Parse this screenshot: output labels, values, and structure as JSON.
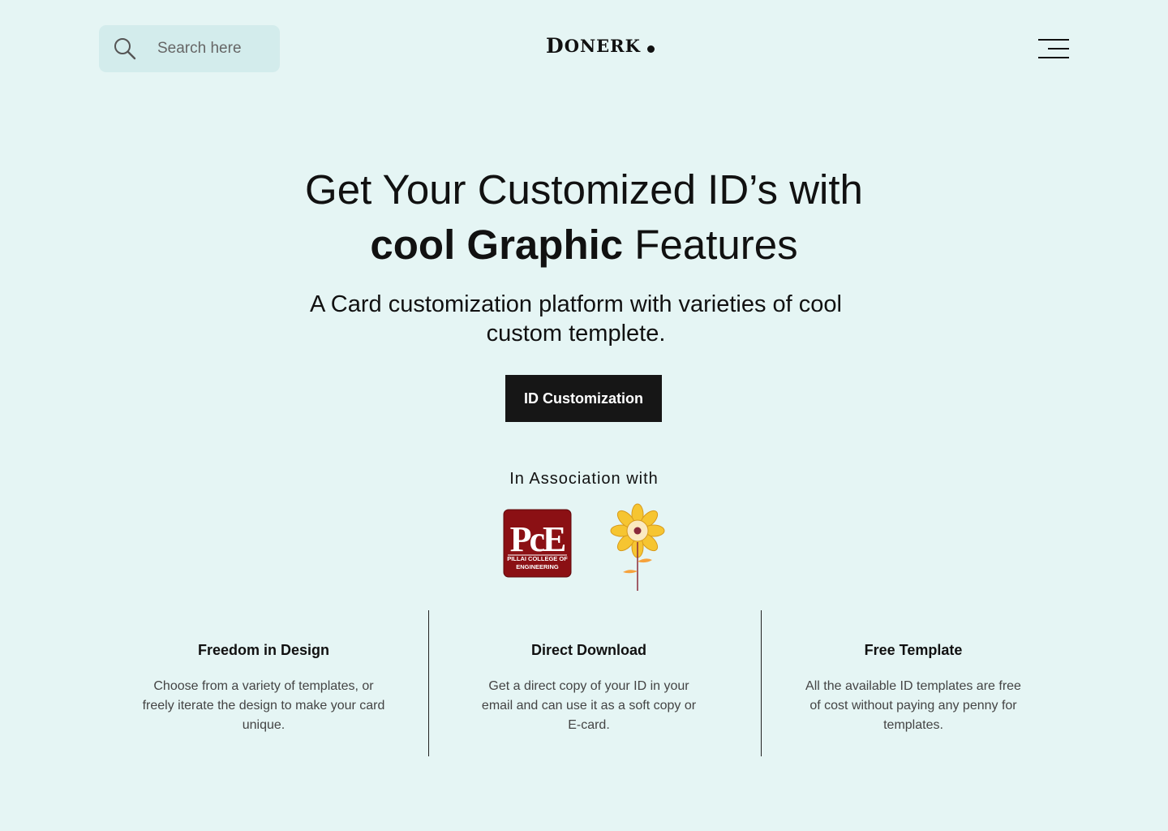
{
  "header": {
    "search_placeholder": "Search here",
    "logo_first": "D",
    "logo_rest": "ONERK"
  },
  "hero": {
    "headline_line1": "Get Your Customized ID’s with",
    "headline_bold": "cool Graphic",
    "headline_rest": " Features",
    "subtitle": "A Card customization platform with varieties of cool custom templete.",
    "cta_label": "ID Customization"
  },
  "association": {
    "label": "In Association with",
    "pce_mark": "PcE",
    "pce_text": "PILLAI COLLEGE OF ENGINEERING"
  },
  "features": [
    {
      "title": "Freedom in Design",
      "description": "Choose from a variety of templates, or freely iterate the design to make your card unique."
    },
    {
      "title": "Direct Download",
      "description": "Get a direct copy of your ID in your email and can use it as a soft copy or E-card."
    },
    {
      "title": "Free Template",
      "description": "All the available ID templates are free of cost without paying any penny for templates."
    }
  ],
  "colors": {
    "background": "#e5f5f4",
    "search_bg": "#d3ecec",
    "cta_bg": "#161616",
    "pce_red": "#8b1014",
    "flower_yellow": "#f6c531"
  },
  "icons": {
    "search": "search-icon",
    "menu": "hamburger-menu-icon"
  }
}
